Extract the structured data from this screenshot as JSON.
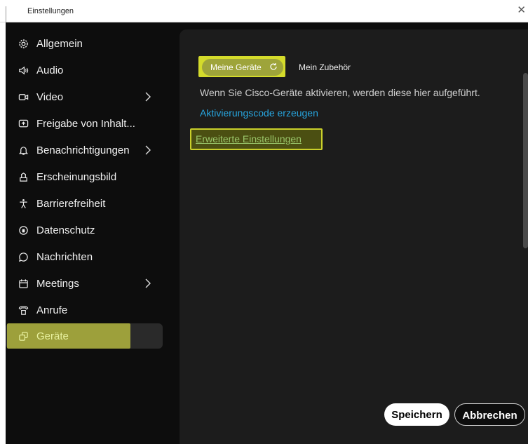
{
  "window": {
    "title": "Einstellungen",
    "close_glyph": "✕"
  },
  "sidebar": {
    "items": [
      {
        "label": "Allgemein",
        "icon": "gear-icon",
        "chevron": false
      },
      {
        "label": "Audio",
        "icon": "speaker-icon",
        "chevron": false
      },
      {
        "label": "Video",
        "icon": "camera-icon",
        "chevron": true
      },
      {
        "label": "Freigabe von Inhalt...",
        "icon": "share-screen-icon",
        "chevron": false
      },
      {
        "label": "Benachrichtigungen",
        "icon": "bell-icon",
        "chevron": true
      },
      {
        "label": "Erscheinungsbild",
        "icon": "appearance-icon",
        "chevron": false
      },
      {
        "label": "Barrierefreiheit",
        "icon": "accessibility-icon",
        "chevron": false
      },
      {
        "label": "Datenschutz",
        "icon": "privacy-icon",
        "chevron": false
      },
      {
        "label": "Nachrichten",
        "icon": "chat-bubble-icon",
        "chevron": false
      },
      {
        "label": "Meetings",
        "icon": "calendar-icon",
        "chevron": true
      },
      {
        "label": "Anrufe",
        "icon": "phone-icon",
        "chevron": false
      },
      {
        "label": "Geräte",
        "icon": "devices-icon",
        "chevron": false,
        "active": true
      }
    ]
  },
  "content": {
    "tabs": [
      {
        "label": "Meine Geräte",
        "selected": true,
        "icon": "refresh-icon"
      },
      {
        "label": "Mein Zubehör",
        "selected": false
      }
    ],
    "description": "Wenn Sie Cisco-Geräte aktivieren, werden diese hier aufgeführt.",
    "activation_link": "Aktivierungscode erzeugen",
    "advanced_link": "Erweiterte Einstellungen"
  },
  "footer": {
    "save_label": "Speichern",
    "cancel_label": "Abbrechen"
  },
  "colors": {
    "highlight": "#d4db2b",
    "link": "#27a6e0",
    "background": "#0d0d0d",
    "panel": "#1c1c1c"
  }
}
